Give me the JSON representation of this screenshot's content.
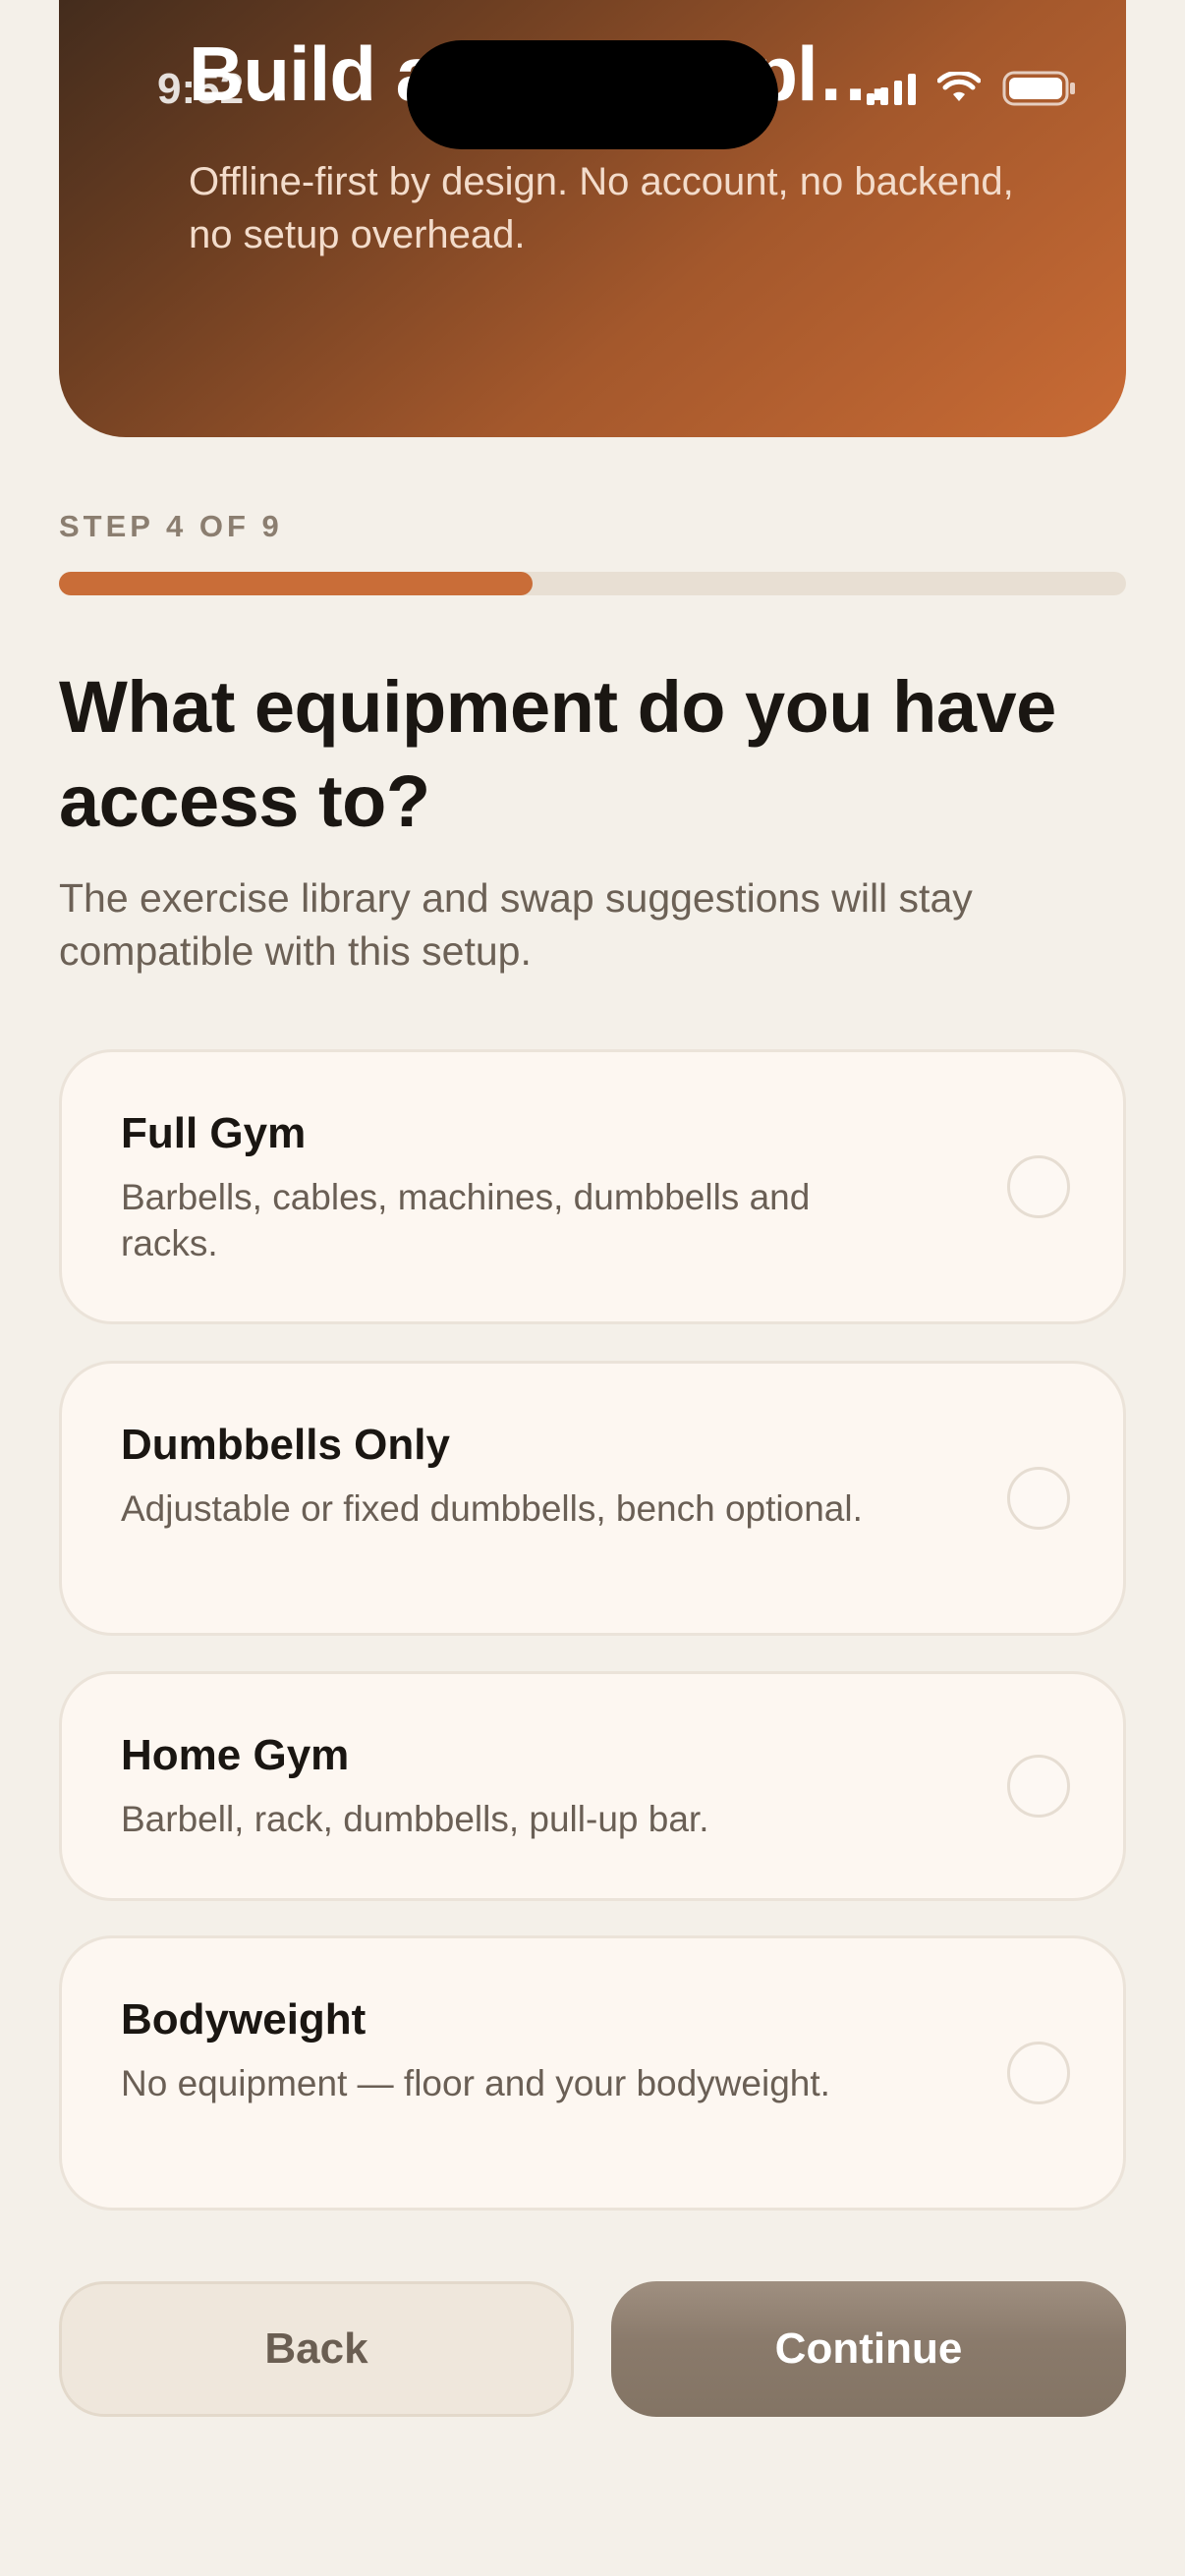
{
  "status_bar": {
    "time": "9:52"
  },
  "hero": {
    "title": "Build a training pl…",
    "subtitle": "Offline-first by design. No account, no backend, no setup overhead."
  },
  "progress": {
    "label": "STEP 4 OF 9",
    "value": 0.444
  },
  "question": {
    "title": "What equipment do you have access to?",
    "subtitle": "The exercise library and swap suggestions will stay compatible with this setup."
  },
  "options": [
    {
      "title": "Full Gym",
      "description": "Barbells, cables, machines, dumbbells and racks.",
      "selected": false
    },
    {
      "title": "Dumbbells Only",
      "description": "Adjustable or fixed dumbbells, bench optional.",
      "selected": false
    },
    {
      "title": "Home Gym",
      "description": "Barbell, rack, dumbbells, pull-up bar.",
      "selected": false
    },
    {
      "title": "Bodyweight",
      "description": "No equipment — floor and your bodyweight.",
      "selected": false
    }
  ],
  "buttons": {
    "back": "Back",
    "continue": "Continue"
  },
  "colors": {
    "accent": "#c96d38",
    "background": "#f4f0e9",
    "card": "#fdf7f1"
  }
}
